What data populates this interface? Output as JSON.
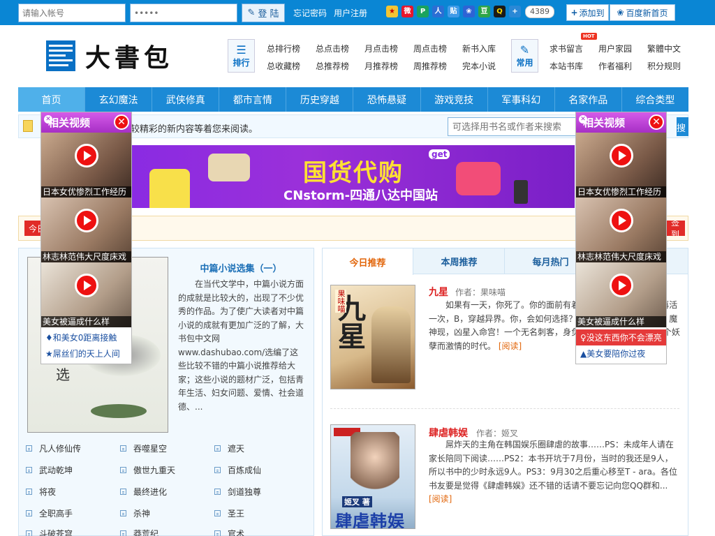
{
  "topbar": {
    "username_placeholder": "请输入帐号",
    "password_placeholder": "•••••",
    "login_label": "登 陆",
    "forgot_label": "忘记密码",
    "register_label": "用户注册",
    "share_count": "4389",
    "add_to_label": "添加到",
    "baidu_home_label": "百度新首页"
  },
  "header": {
    "logo_text": "大書包",
    "rank_box_label": "排行",
    "common_box_label": "常用",
    "hot_badge": "HOT",
    "rank_links": [
      "总排行榜",
      "总点击榜",
      "月点击榜",
      "周点击榜",
      "新书入库",
      "总收藏榜",
      "总推荐榜",
      "月推荐榜",
      "周推荐榜",
      "完本小说"
    ],
    "common_links": [
      "求书留言",
      "用户家园",
      "繁體中文",
      "本站书库",
      "作者福利",
      "积分规则"
    ]
  },
  "nav": {
    "items": [
      "首页",
      "玄幻魔法",
      "武侠修真",
      "都市言情",
      "历史穿越",
      "恐怖悬疑",
      "游戏竞技",
      "军事科幻",
      "名家作品",
      "综合类型"
    ]
  },
  "notice": {
    "text": "较精彩的新内容等着您来阅读。",
    "search_placeholder": "可选择用书名或作者来搜索",
    "search_button": "搜索"
  },
  "banner": {
    "title": "国货代购",
    "subtitle": "CNstorm-四通八达中国站",
    "tag": "get"
  },
  "strip2": {
    "left_label": "今日",
    "right_label": "签到"
  },
  "left_panel": {
    "title": "中篇小说选集（一）",
    "description": "在当代文学中，中篇小说方面的成就是比较大的，出现了不少优秀的作品。为了使广大读者对中篇小说的成就有更加广泛的了解，大书包中文网www.dashubao.com/选编了这些比较不错的中篇小说推荐给大家；这些小说的题材广泛，包括青年生活、妇女问题、爱情、社会道德、...",
    "books": [
      "凡人修仙传",
      "吞噬星空",
      "遮天",
      "武动乾坤",
      "傲世九重天",
      "百炼成仙",
      "将夜",
      "最终进化",
      "剑道独尊",
      "全职高手",
      "杀神",
      "圣王",
      "斗破苍穹",
      "莽荒纪",
      "官术"
    ]
  },
  "right_panel": {
    "tabs": [
      "今日推荐",
      "本周推荐",
      "每月热门"
    ],
    "books": [
      {
        "title": "九星",
        "author_label": "作者：果味喵",
        "cover_title": "九星",
        "cover_author": "果味喵",
        "desc": "如果有一天，你死了。你的面前有着两个选择：A，转世，再活一次，B，穿越异界。你，会如何选择？，这是一个穿越的故事，魔神现，凶星入命宫！一个无名刺客，身负紫金星命格，引出了这个妖孽而激情的时代。",
        "read": "[阅读]"
      },
      {
        "title": "肆虐韩娱",
        "author_label": "作者：姬叉",
        "cover_title": "肆虐韩娱",
        "cover_author": "姬叉 著",
        "desc": "屌炸天的主角在韩国娱乐圈肆虐的故事……PS：未成年人请在家长陪同下阅读……PS2：本书开坑于7月份，当时的我还是9人，所以书中的少时永远9人。PS3：9月30之后重心移至T - ara。各位书友要是觉得《肆虐韩娱》还不错的话请不要忘记向您QQ群和...",
        "read": "[阅读]"
      }
    ]
  },
  "video_popups": {
    "header": "相关视频",
    "captions": [
      "日本女优惨烈工作经历",
      "林志林范伟大尺度床戏",
      "美女被逼成什么样"
    ],
    "left_links": [
      "♦和美女0距离接触",
      "★屌丝们的天上人间"
    ],
    "right_links": [
      "♀没这东西你不会漂亮",
      "▲美女要陪你过夜"
    ]
  },
  "colors": {
    "brand_blue": "#1c8ad6",
    "topbar_blue": "#0a86d4",
    "accent_orange": "#e2660b",
    "title_red": "#d22",
    "popup_purple": "#a72fc5"
  }
}
